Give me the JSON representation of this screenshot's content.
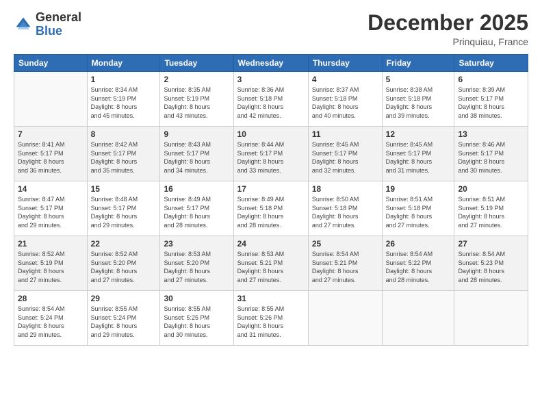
{
  "header": {
    "logo_general": "General",
    "logo_blue": "Blue",
    "month": "December 2025",
    "location": "Prinquiau, France"
  },
  "weekdays": [
    "Sunday",
    "Monday",
    "Tuesday",
    "Wednesday",
    "Thursday",
    "Friday",
    "Saturday"
  ],
  "weeks": [
    [
      {
        "day": "",
        "info": ""
      },
      {
        "day": "1",
        "info": "Sunrise: 8:34 AM\nSunset: 5:19 PM\nDaylight: 8 hours\nand 45 minutes."
      },
      {
        "day": "2",
        "info": "Sunrise: 8:35 AM\nSunset: 5:19 PM\nDaylight: 8 hours\nand 43 minutes."
      },
      {
        "day": "3",
        "info": "Sunrise: 8:36 AM\nSunset: 5:18 PM\nDaylight: 8 hours\nand 42 minutes."
      },
      {
        "day": "4",
        "info": "Sunrise: 8:37 AM\nSunset: 5:18 PM\nDaylight: 8 hours\nand 40 minutes."
      },
      {
        "day": "5",
        "info": "Sunrise: 8:38 AM\nSunset: 5:18 PM\nDaylight: 8 hours\nand 39 minutes."
      },
      {
        "day": "6",
        "info": "Sunrise: 8:39 AM\nSunset: 5:17 PM\nDaylight: 8 hours\nand 38 minutes."
      }
    ],
    [
      {
        "day": "7",
        "info": "Sunrise: 8:41 AM\nSunset: 5:17 PM\nDaylight: 8 hours\nand 36 minutes."
      },
      {
        "day": "8",
        "info": "Sunrise: 8:42 AM\nSunset: 5:17 PM\nDaylight: 8 hours\nand 35 minutes."
      },
      {
        "day": "9",
        "info": "Sunrise: 8:43 AM\nSunset: 5:17 PM\nDaylight: 8 hours\nand 34 minutes."
      },
      {
        "day": "10",
        "info": "Sunrise: 8:44 AM\nSunset: 5:17 PM\nDaylight: 8 hours\nand 33 minutes."
      },
      {
        "day": "11",
        "info": "Sunrise: 8:45 AM\nSunset: 5:17 PM\nDaylight: 8 hours\nand 32 minutes."
      },
      {
        "day": "12",
        "info": "Sunrise: 8:45 AM\nSunset: 5:17 PM\nDaylight: 8 hours\nand 31 minutes."
      },
      {
        "day": "13",
        "info": "Sunrise: 8:46 AM\nSunset: 5:17 PM\nDaylight: 8 hours\nand 30 minutes."
      }
    ],
    [
      {
        "day": "14",
        "info": "Sunrise: 8:47 AM\nSunset: 5:17 PM\nDaylight: 8 hours\nand 29 minutes."
      },
      {
        "day": "15",
        "info": "Sunrise: 8:48 AM\nSunset: 5:17 PM\nDaylight: 8 hours\nand 29 minutes."
      },
      {
        "day": "16",
        "info": "Sunrise: 8:49 AM\nSunset: 5:17 PM\nDaylight: 8 hours\nand 28 minutes."
      },
      {
        "day": "17",
        "info": "Sunrise: 8:49 AM\nSunset: 5:18 PM\nDaylight: 8 hours\nand 28 minutes."
      },
      {
        "day": "18",
        "info": "Sunrise: 8:50 AM\nSunset: 5:18 PM\nDaylight: 8 hours\nand 27 minutes."
      },
      {
        "day": "19",
        "info": "Sunrise: 8:51 AM\nSunset: 5:18 PM\nDaylight: 8 hours\nand 27 minutes."
      },
      {
        "day": "20",
        "info": "Sunrise: 8:51 AM\nSunset: 5:19 PM\nDaylight: 8 hours\nand 27 minutes."
      }
    ],
    [
      {
        "day": "21",
        "info": "Sunrise: 8:52 AM\nSunset: 5:19 PM\nDaylight: 8 hours\nand 27 minutes."
      },
      {
        "day": "22",
        "info": "Sunrise: 8:52 AM\nSunset: 5:20 PM\nDaylight: 8 hours\nand 27 minutes."
      },
      {
        "day": "23",
        "info": "Sunrise: 8:53 AM\nSunset: 5:20 PM\nDaylight: 8 hours\nand 27 minutes."
      },
      {
        "day": "24",
        "info": "Sunrise: 8:53 AM\nSunset: 5:21 PM\nDaylight: 8 hours\nand 27 minutes."
      },
      {
        "day": "25",
        "info": "Sunrise: 8:54 AM\nSunset: 5:21 PM\nDaylight: 8 hours\nand 27 minutes."
      },
      {
        "day": "26",
        "info": "Sunrise: 8:54 AM\nSunset: 5:22 PM\nDaylight: 8 hours\nand 28 minutes."
      },
      {
        "day": "27",
        "info": "Sunrise: 8:54 AM\nSunset: 5:23 PM\nDaylight: 8 hours\nand 28 minutes."
      }
    ],
    [
      {
        "day": "28",
        "info": "Sunrise: 8:54 AM\nSunset: 5:24 PM\nDaylight: 8 hours\nand 29 minutes."
      },
      {
        "day": "29",
        "info": "Sunrise: 8:55 AM\nSunset: 5:24 PM\nDaylight: 8 hours\nand 29 minutes."
      },
      {
        "day": "30",
        "info": "Sunrise: 8:55 AM\nSunset: 5:25 PM\nDaylight: 8 hours\nand 30 minutes."
      },
      {
        "day": "31",
        "info": "Sunrise: 8:55 AM\nSunset: 5:26 PM\nDaylight: 8 hours\nand 31 minutes."
      },
      {
        "day": "",
        "info": ""
      },
      {
        "day": "",
        "info": ""
      },
      {
        "day": "",
        "info": ""
      }
    ]
  ]
}
